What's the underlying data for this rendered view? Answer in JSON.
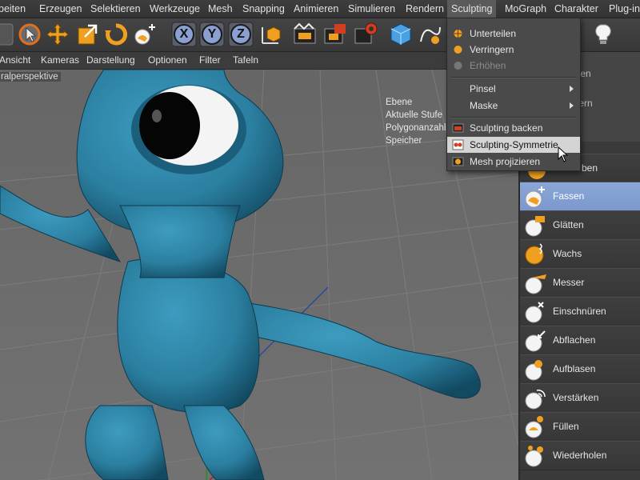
{
  "menubar": {
    "items": [
      "beiten",
      "Erzeugen",
      "Selektieren",
      "Werkzeuge",
      "Mesh",
      "Snapping",
      "Animieren",
      "Simulieren",
      "Rendern",
      "Sculpting",
      "MoGraph",
      "Charakter",
      "Plug-in"
    ],
    "active": "Sculpting"
  },
  "toolbar": {
    "icons": [
      "rect-select-icon",
      "live-select-icon",
      "move-icon",
      "scale-icon",
      "rotate-icon",
      "brush-grab-icon",
      "axis-x-icon",
      "axis-y-icon",
      "axis-z-icon",
      "coordinate-system-icon",
      "render-view-icon",
      "render-picture-icon",
      "render-settings-icon",
      "cube-icon",
      "spline-pen-icon",
      "light-icon"
    ],
    "x_label": "X",
    "y_label": "Y",
    "z_label": "Z"
  },
  "viewmenu": {
    "items": [
      "Ansicht",
      "Kameras",
      "Darstellung",
      "Optionen",
      "Filter",
      "Tafeln"
    ]
  },
  "viewport": {
    "label": "ralperspektive",
    "hud": [
      "Ebene",
      "Aktuelle Stufe",
      "Polygonanzahl",
      "Speicher"
    ],
    "model_color": "#2b7fa0"
  },
  "sculpt_menu": {
    "items": [
      {
        "label": "Unterteilen",
        "icon": "subdivide-icon",
        "state": "normal"
      },
      {
        "label": "Verringern",
        "icon": "decrease-icon",
        "state": "normal"
      },
      {
        "label": "Erhöhen",
        "icon": "increase-icon",
        "state": "disabled"
      },
      {
        "label": "Pinsel",
        "icon": "",
        "state": "submenu"
      },
      {
        "label": "Maske",
        "icon": "",
        "state": "submenu"
      },
      {
        "label": "Sculpting backen",
        "icon": "bake-icon",
        "state": "normal"
      },
      {
        "label": "Sculpting-Symmetrie",
        "icon": "symmetry-icon",
        "state": "highlighted"
      },
      {
        "label": "Mesh projizieren",
        "icon": "project-mesh-icon",
        "state": "normal"
      }
    ]
  },
  "rightpanel": {
    "top_items": [
      "teilen",
      "ngern",
      "en"
    ],
    "partial_label": "ben",
    "brushes": [
      {
        "label": "Fassen",
        "icon": "grab-brush-icon",
        "selected": true
      },
      {
        "label": "Glätten",
        "icon": "smooth-brush-icon",
        "selected": false
      },
      {
        "label": "Wachs",
        "icon": "wax-brush-icon",
        "selected": false
      },
      {
        "label": "Messer",
        "icon": "knife-brush-icon",
        "selected": false
      },
      {
        "label": "Einschnüren",
        "icon": "pinch-brush-icon",
        "selected": false
      },
      {
        "label": "Abflachen",
        "icon": "flatten-brush-icon",
        "selected": false
      },
      {
        "label": "Aufblasen",
        "icon": "inflate-brush-icon",
        "selected": false
      },
      {
        "label": "Verstärken",
        "icon": "amplify-brush-icon",
        "selected": false
      },
      {
        "label": "Füllen",
        "icon": "fill-brush-icon",
        "selected": false
      },
      {
        "label": "Wiederholen",
        "icon": "repeat-brush-icon",
        "selected": false
      }
    ]
  },
  "colors": {
    "selected_brush": "#8ba7d9",
    "menu_highlight": "#d4d4d4",
    "accent_orange": "#f0a020"
  }
}
